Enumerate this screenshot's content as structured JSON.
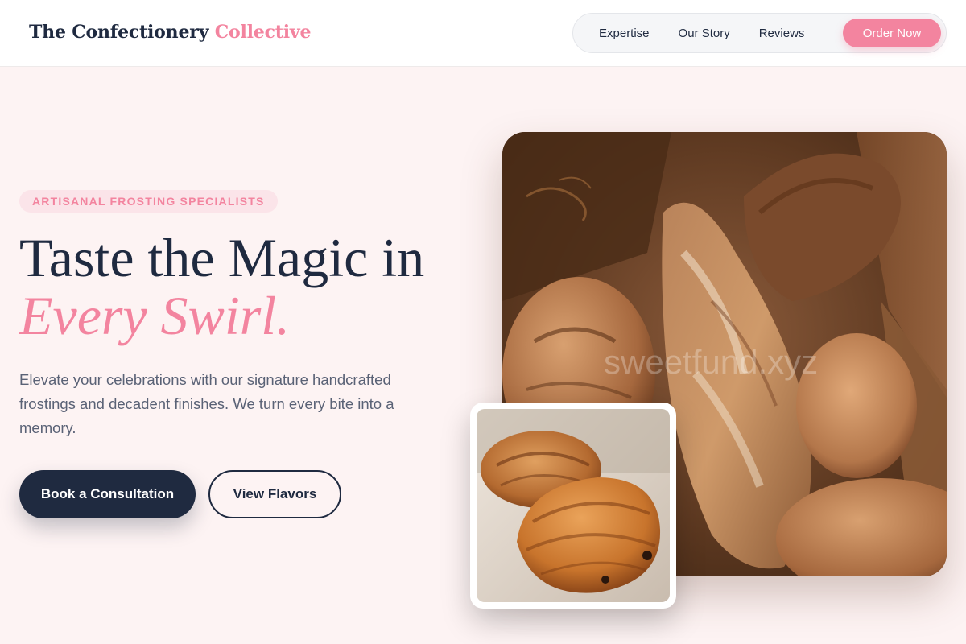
{
  "brand": {
    "name": "The Confectionery",
    "accent": "Collective"
  },
  "nav": {
    "links": [
      "Expertise",
      "Our Story",
      "Reviews"
    ],
    "cta": "Order Now"
  },
  "hero": {
    "eyebrow": "ARTISANAL FROSTING SPECIALISTS",
    "headline_line1": "Taste the Magic in",
    "headline_line2": "Every Swirl.",
    "lede": "Elevate your celebrations with our signature handcrafted frostings and decadent finishes. We turn every bite into a memory.",
    "primary_cta": "Book a Consultation",
    "secondary_cta": "View Flavors"
  },
  "images": {
    "main_alt": "Rustic artisan breads in a brown paper bag",
    "main_watermark": "sweetfund.xyz",
    "inset_alt": "Golden croissant and pain au chocolat"
  },
  "colors": {
    "accent": "#f3849f",
    "navy": "#1f2a40",
    "background": "#fdf3f3"
  }
}
